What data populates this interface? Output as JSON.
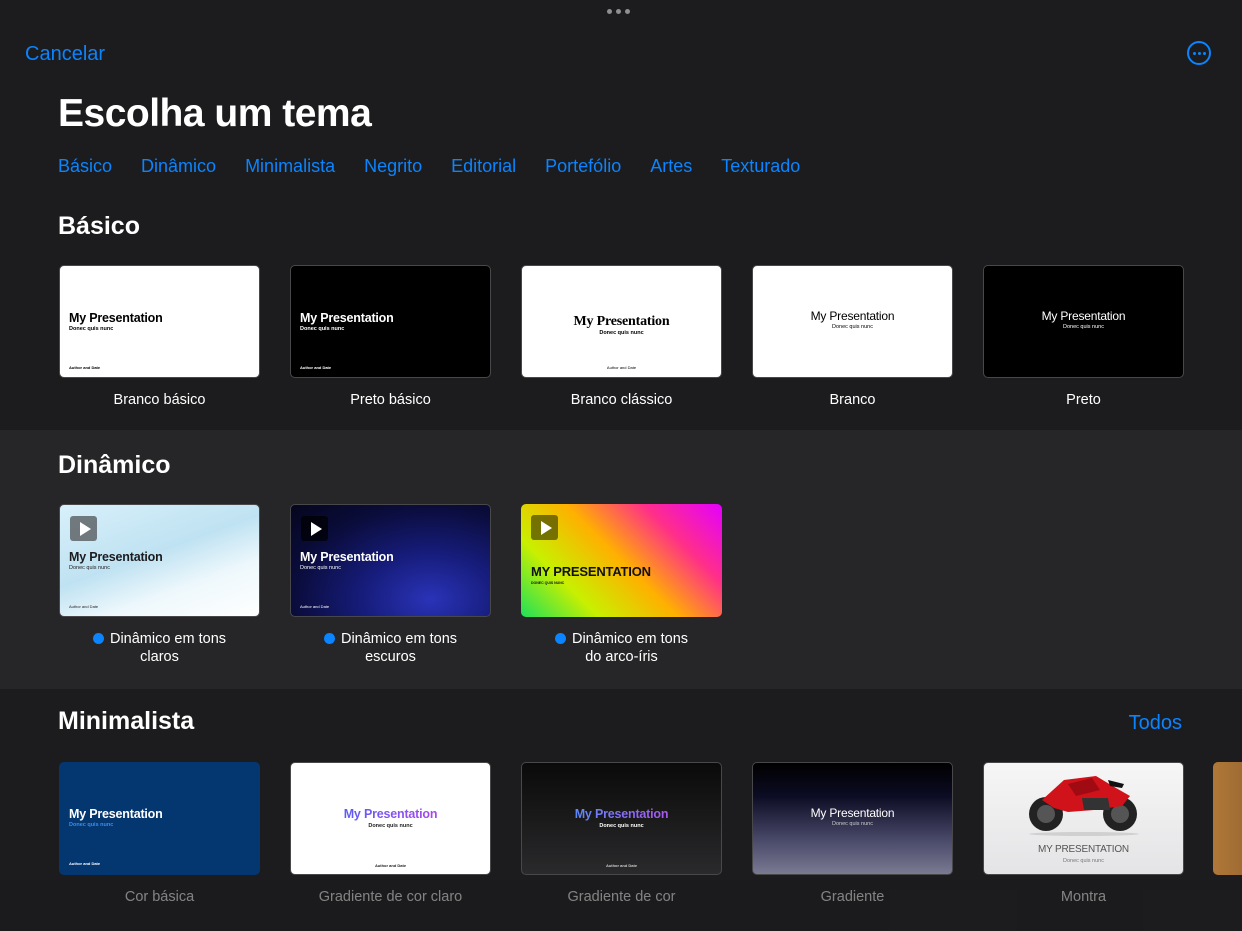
{
  "header": {
    "cancel_label": "Cancelar",
    "more_icon": "ellipsis-circle-icon",
    "title": "Escolha um tema"
  },
  "categories": [
    "Básico",
    "Dinâmico",
    "Minimalista",
    "Negrito",
    "Editorial",
    "Portefólio",
    "Artes",
    "Texturado"
  ],
  "sections": {
    "basic": {
      "title": "Básico",
      "themes": [
        {
          "name": "Branco básico",
          "mp": "My Presentation",
          "sub": "Donec quis nunc",
          "author": "Author and Date"
        },
        {
          "name": "Preto básico",
          "mp": "My Presentation",
          "sub": "Donec quis nunc",
          "author": "Author and Date"
        },
        {
          "name": "Branco clássico",
          "mp": "My Presentation",
          "sub": "Donec quis nunc",
          "author": "Author and Date"
        },
        {
          "name": "Branco",
          "mp": "My Presentation",
          "sub": "Donec quis nunc"
        },
        {
          "name": "Preto",
          "mp": "My Presentation",
          "sub": "Donec quis nunc"
        }
      ]
    },
    "dynamic": {
      "title": "Dinâmico",
      "themes": [
        {
          "name_line1": "Dinâmico em tons",
          "name_line2": "claros",
          "mp": "My Presentation",
          "sub": "Donec quis nunc",
          "author": "Author and Date"
        },
        {
          "name_line1": "Dinâmico em tons",
          "name_line2": "escuros",
          "mp": "My Presentation",
          "sub": "Donec quis nunc",
          "author": "Author and Date"
        },
        {
          "name_line1": "Dinâmico em tons",
          "name_line2": "do arco-íris",
          "mp": "MY PRESENTATION",
          "sub": "DONEC QUIS NUNC"
        }
      ]
    },
    "minimal": {
      "title": "Minimalista",
      "all_label": "Todos",
      "themes": [
        {
          "name": "Cor básica",
          "mp": "My Presentation",
          "sub": "Donec quis nunc",
          "author": "Author and Date"
        },
        {
          "name": "Gradiente de cor claro",
          "mp": "My Presentation",
          "sub": "Donec quis nunc",
          "author": "Author and Date"
        },
        {
          "name": "Gradiente de cor",
          "mp": "My Presentation",
          "sub": "Donec quis nunc",
          "author": "Author and Date"
        },
        {
          "name": "Gradiente",
          "mp": "My Presentation",
          "sub": "Donec quis nunc"
        },
        {
          "name": "Montra",
          "mp": "MY PRESENTATION",
          "sub": "Donec quis nunc"
        }
      ]
    }
  },
  "colors": {
    "accent": "#0a84ff",
    "background": "#1c1c1e",
    "dynamic_bg": "#262628"
  }
}
